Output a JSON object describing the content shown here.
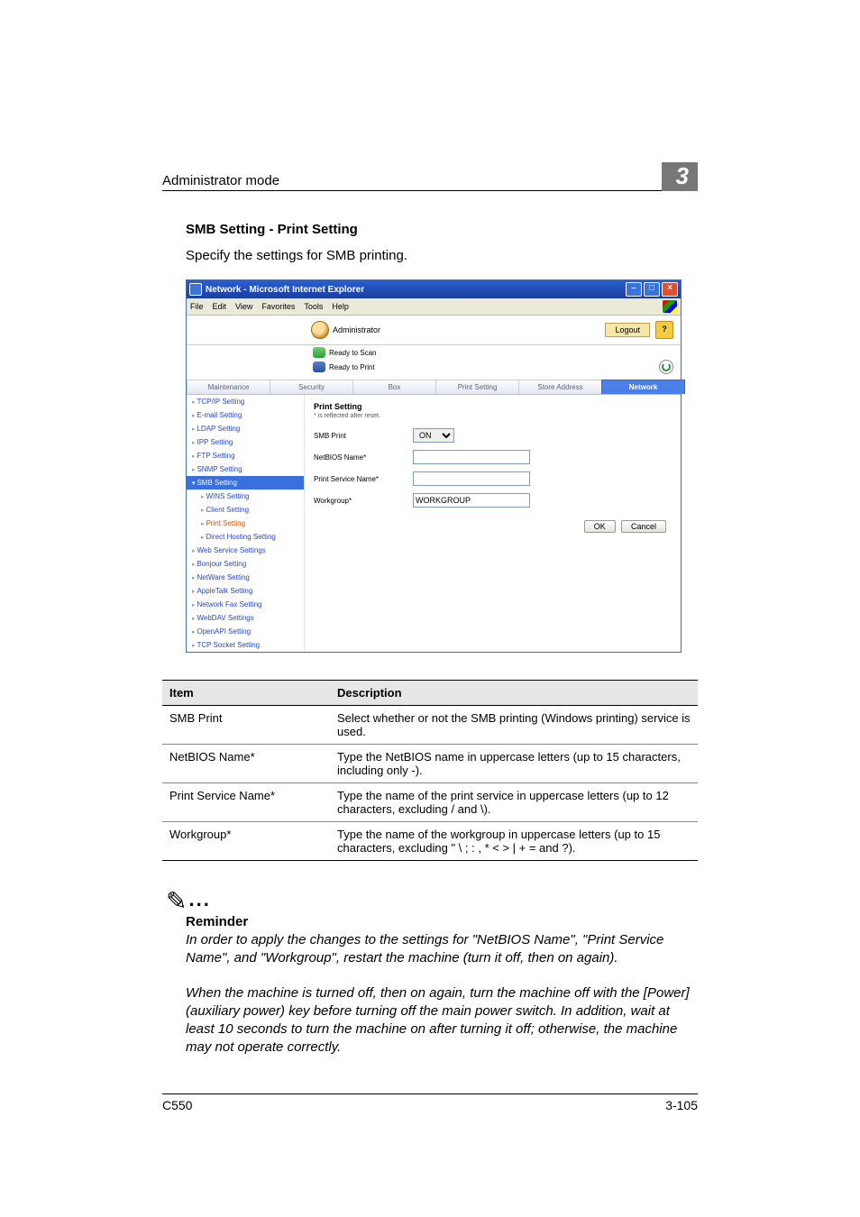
{
  "header": {
    "title": "Administrator mode",
    "chapter": "3"
  },
  "section": {
    "title": "SMB Setting - Print Setting",
    "intro": "Specify the settings for SMB printing."
  },
  "ie": {
    "title": "Network - Microsoft Internet Explorer",
    "menus": [
      "File",
      "Edit",
      "View",
      "Favorites",
      "Tools",
      "Help"
    ],
    "admin_label": "Administrator",
    "logout": "Logout",
    "status_scan": "Ready to Scan",
    "status_print": "Ready to Print",
    "tabs": [
      "Maintenance",
      "Security",
      "Box",
      "Print Setting",
      "Store Address",
      "Network"
    ],
    "active_tab": 5,
    "sidebar_top": [
      "TCP/IP Setting",
      "E-mail Setting",
      "LDAP Setting",
      "IPP Setting",
      "FTP Setting",
      "SNMP Setting"
    ],
    "sidebar_group": "SMB Setting",
    "sidebar_sub": [
      "WINS Setting",
      "Client Setting",
      "Print Setting",
      "Direct Hosting Setting"
    ],
    "sidebar_sub_active": 2,
    "sidebar_bottom": [
      "Web Service Settings",
      "Bonjour Setting",
      "NetWare Setting",
      "AppleTalk Setting",
      "Network Fax Setting",
      "WebDAV Settings",
      "OpenAPI Setting",
      "TCP Socket Setting"
    ],
    "content": {
      "heading": "Print Setting",
      "note": "* is reflected after reset.",
      "fields": {
        "smb_print_label": "SMB Print",
        "smb_print_value": "ON",
        "netbios_label": "NetBIOS Name*",
        "netbios_value": "",
        "printsvc_label": "Print Service Name*",
        "printsvc_value": "",
        "workgroup_label": "Workgroup*",
        "workgroup_value": "WORKGROUP"
      },
      "ok": "OK",
      "cancel": "Cancel"
    }
  },
  "table": {
    "head_item": "Item",
    "head_desc": "Description",
    "rows": [
      {
        "item": "SMB Print",
        "desc": "Select whether or not the SMB printing (Windows printing) service is used."
      },
      {
        "item": "NetBIOS Name*",
        "desc": "Type the NetBIOS name in uppercase letters (up to 15 characters, including only -)."
      },
      {
        "item": "Print Service Name*",
        "desc": "Type the name of the print service in uppercase letters (up to 12 characters, excluding / and \\)."
      },
      {
        "item": "Workgroup*",
        "desc": "Type the name of the workgroup in uppercase letters (up to 15 characters, excluding \" \\ ; : , * < > | + = and ?)."
      }
    ]
  },
  "reminder": {
    "head": "Reminder",
    "p1": "In order to apply the changes to the settings for \"NetBIOS Name\", \"Print Service Name\", and \"Workgroup\", restart the machine (turn it off, then on again).",
    "p2": "When the machine is turned off, then on again, turn the machine off with the [Power] (auxiliary power) key before turning off the main power switch. In addition, wait at least 10 seconds to turn the machine on after turning it off; otherwise, the machine may not operate correctly."
  },
  "footer": {
    "left": "C550",
    "right": "3-105"
  }
}
